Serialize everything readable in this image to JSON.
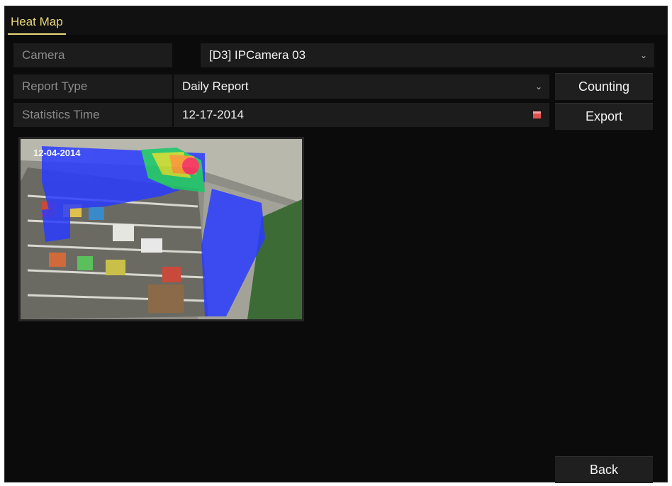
{
  "tab": {
    "label": "Heat Map"
  },
  "camera": {
    "label": "Camera",
    "value": "[D3] IPCamera 03"
  },
  "report_type": {
    "label": "Report Type",
    "value": "Daily Report"
  },
  "statistics_time": {
    "label": "Statistics Time",
    "value": "12-17-2014"
  },
  "buttons": {
    "counting": "Counting",
    "export": "Export",
    "back": "Back"
  },
  "preview": {
    "timestamp": "12-04-2014"
  },
  "colors": {
    "accent": "#e8d77a",
    "background": "#0b0b0b",
    "panel": "#1c1c1c",
    "heat_low": "#2a3cff",
    "heat_mid": "#18c96a",
    "heat_high": "#ff2a5a"
  },
  "icons": {
    "dropdown": "chevron-down-icon",
    "calendar": "calendar-icon"
  }
}
